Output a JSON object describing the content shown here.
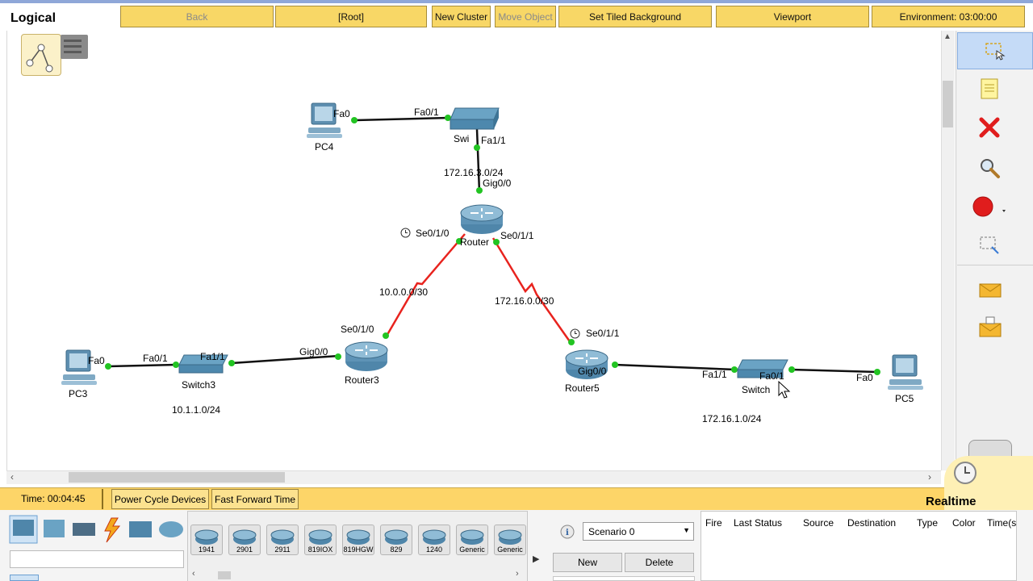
{
  "header": {
    "mode": "Logical",
    "back": "Back",
    "root": "[Root]",
    "new_cluster": "New Cluster",
    "move_object": "Move Object",
    "set_tiled_background": "Set Tiled Background",
    "viewport": "Viewport",
    "environment": "Environment: 03:00:00"
  },
  "topology": {
    "pc4": {
      "name": "PC4",
      "port": "Fa0"
    },
    "top_switch": {
      "name": "Swi",
      "port_left": "Fa0/1",
      "port_down": "Fa1/1"
    },
    "net_top": "172.16.3.0/24",
    "router_mid": {
      "name": "Router",
      "port_up": "Gig0/0",
      "port_left": "Se0/1/0",
      "port_right": "Se0/1/1"
    },
    "net_left_serial": "10.0.0.0/30",
    "net_right_serial": "172.16.0.0/30",
    "router3": {
      "name": "Router3",
      "port_serial": "Se0/1/0",
      "port_gig": "Gig0/0"
    },
    "router5": {
      "name": "Router5",
      "port_serial": "Se0/1/1",
      "port_gig": "Gig0/0"
    },
    "switch3": {
      "name": "Switch3",
      "port_left": "Fa0/1",
      "port_right": "Fa1/1"
    },
    "pc3": {
      "name": "PC3",
      "port": "Fa0"
    },
    "net_left_lan": "10.1.1.0/24",
    "switch_right": {
      "name": "Switch",
      "port_left": "Fa1/1",
      "port_right": "Fa0/1"
    },
    "pc5": {
      "name": "PC5",
      "port": "Fa0"
    },
    "net_right_lan": "172.16.1.0/24"
  },
  "statusbar": {
    "time": "Time: 00:04:45",
    "power_cycle": "Power Cycle Devices",
    "fast_forward": "Fast Forward Time",
    "mode": "Realtime"
  },
  "devices": {
    "models": [
      "1941",
      "2901",
      "2911",
      "819IOX",
      "819HGW",
      "829",
      "1240",
      "Generic",
      "Generic"
    ]
  },
  "scenario": {
    "selected": "Scenario 0",
    "new_label": "New",
    "delete_label": "Delete"
  },
  "pdu_table": {
    "columns": [
      "Fire",
      "Last Status",
      "Source",
      "Destination",
      "Type",
      "Color",
      "Time(s"
    ]
  },
  "colors": {
    "accent_yellow": "#f8d766",
    "serial_link": "#e8231e",
    "link_up": "#22c422",
    "ethernet_link": "#111111"
  }
}
